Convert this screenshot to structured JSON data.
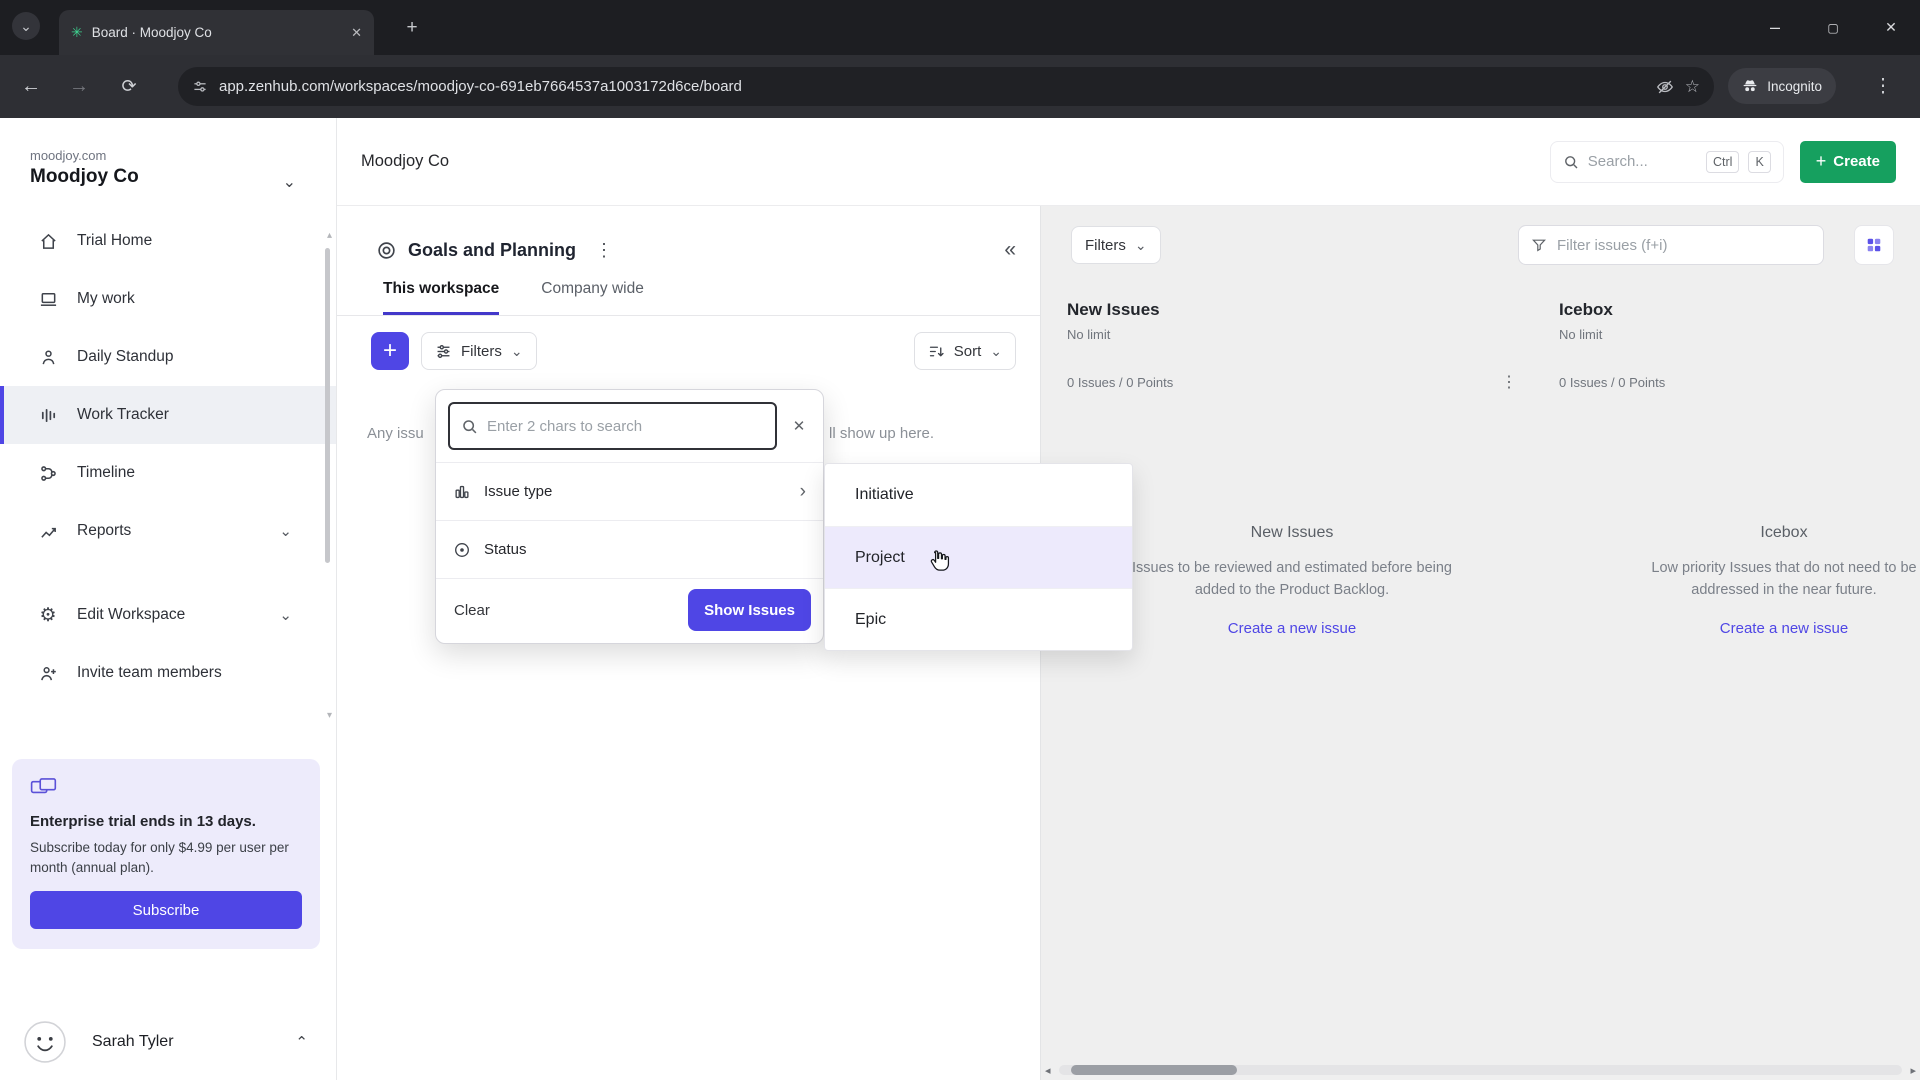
{
  "colors": {
    "accent": "#4f46e5",
    "create_green": "#16a05f",
    "board_bg": "#efefef",
    "promo_bg": "#edebfb",
    "hover_lavender": "#edeafc",
    "tab_underline": "#4338ca"
  },
  "browser": {
    "tab": {
      "title": "Board · Moodjoy Co"
    },
    "address": {
      "url": "app.zenhub.com/workspaces/moodjoy-co-691eb7664537a1003172d6ce/board"
    },
    "incognito_label": "Incognito"
  },
  "sidebar": {
    "domain": "moodjoy.com",
    "workspace": "Moodjoy Co",
    "nav": [
      {
        "label": "Trial Home"
      },
      {
        "label": "My work"
      },
      {
        "label": "Daily Standup"
      },
      {
        "label": "Work Tracker"
      },
      {
        "label": "Timeline"
      },
      {
        "label": "Reports"
      },
      {
        "label": "Edit Workspace"
      },
      {
        "label": "Invite team members"
      }
    ],
    "promo": {
      "title": "Enterprise trial ends in 13 days.",
      "body": "Subscribe today for only $4.99 per user per month (annual plan).",
      "cta": "Subscribe"
    },
    "user": {
      "name": "Sarah Tyler"
    }
  },
  "header": {
    "breadcrumb": "Moodjoy Co",
    "search_placeholder": "Search...",
    "key1": "Ctrl",
    "key2": "K",
    "create": "Create"
  },
  "panel": {
    "title": "Goals and Planning",
    "tab_active": "This workspace",
    "tab_inactive": "Company wide",
    "filters": "Filters",
    "sort": "Sort",
    "empty_left": "Any issu",
    "empty_right": "ll show up here."
  },
  "filter_menu": {
    "search_placeholder": "Enter 2 chars to search",
    "items": [
      {
        "label": "Issue type"
      },
      {
        "label": "Status"
      }
    ],
    "clear": "Clear",
    "show_issues": "Show Issues",
    "submenu": [
      "Initiative",
      "Project",
      "Epic"
    ]
  },
  "board": {
    "filters_button": "Filters",
    "filter_input_placeholder": "Filter issues (f+i)",
    "columns": [
      {
        "name": "New Issues",
        "limit": "No limit",
        "stats": "0 Issues / 0 Points",
        "description": "Issues to be reviewed and estimated before being added to the Product Backlog.",
        "cta": "Create a new issue"
      },
      {
        "name": "Icebox",
        "limit": "No limit",
        "stats": "0 Issues / 0 Points",
        "description": "Low priority Issues that do not need to be addressed in the near future.",
        "cta": "Create a new issue"
      }
    ]
  }
}
